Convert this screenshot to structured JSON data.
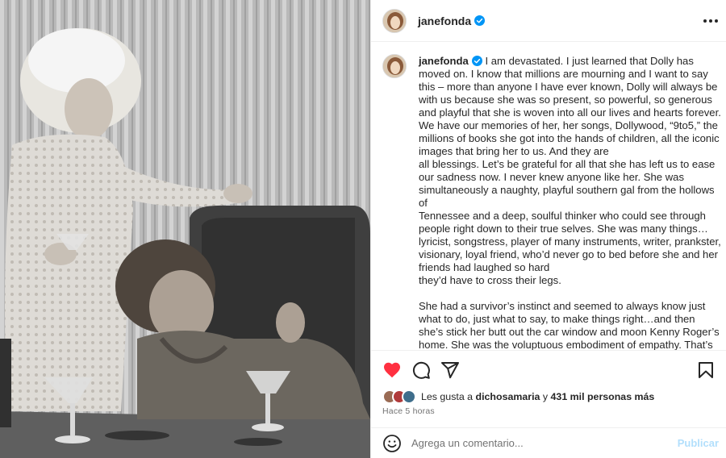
{
  "post": {
    "username": "janefonda",
    "verified": true,
    "more_icon": "more-horizontal-icon",
    "caption_paragraphs": [
      "I am devastated. I just learned that Dolly has moved on. I know that millions are mourning and I want to say this – more than anyone I have ever known, Dolly will always be with us because she was so present, so powerful, so generous and playful that she is woven into all our lives and hearts forever. We have our memories of her, her songs, Dollywood, “9to5,” the millions of books she got into the hands of children, all the iconic images that bring her to us. And they are",
      "all blessings. Let’s be grateful for all that she has left us to ease our sadness now. I never knew anyone like her. She was simultaneously a naughty, playful southern gal from the hollows of",
      "Tennessee and a deep, soulful thinker who could see through people right down to their true selves. She was many things… lyricist, songstress, player of many instruments, writer, prankster, visionary, loyal friend, who’d never go to bed before she and her friends had laughed so hard",
      "they’d have to cross their legs.",
      "She had a survivor’s instinct and seemed to always know just what to do, just what to say, to make things right…and then she’s stick her butt out the car window and moon Kenny Roger’s home. She was the voluptuous embodiment of empathy. That’s"
    ],
    "actions": {
      "like_icon": "heart-filled-icon",
      "comment_icon": "comment-bubble-icon",
      "share_icon": "send-paper-plane-icon",
      "save_icon": "bookmark-icon",
      "like_color": "#ff3040"
    },
    "likes": {
      "prefix": "Les gusta a",
      "first_user": "dichosamaria",
      "connector": "y",
      "count": "431 mil personas más"
    },
    "time": "Hace 5 horas",
    "comment": {
      "emoji_icon": "emoji-smile-icon",
      "placeholder": "Agrega un comentario...",
      "publish_label": "Publicar",
      "publish_color": "#b2dffc"
    }
  }
}
